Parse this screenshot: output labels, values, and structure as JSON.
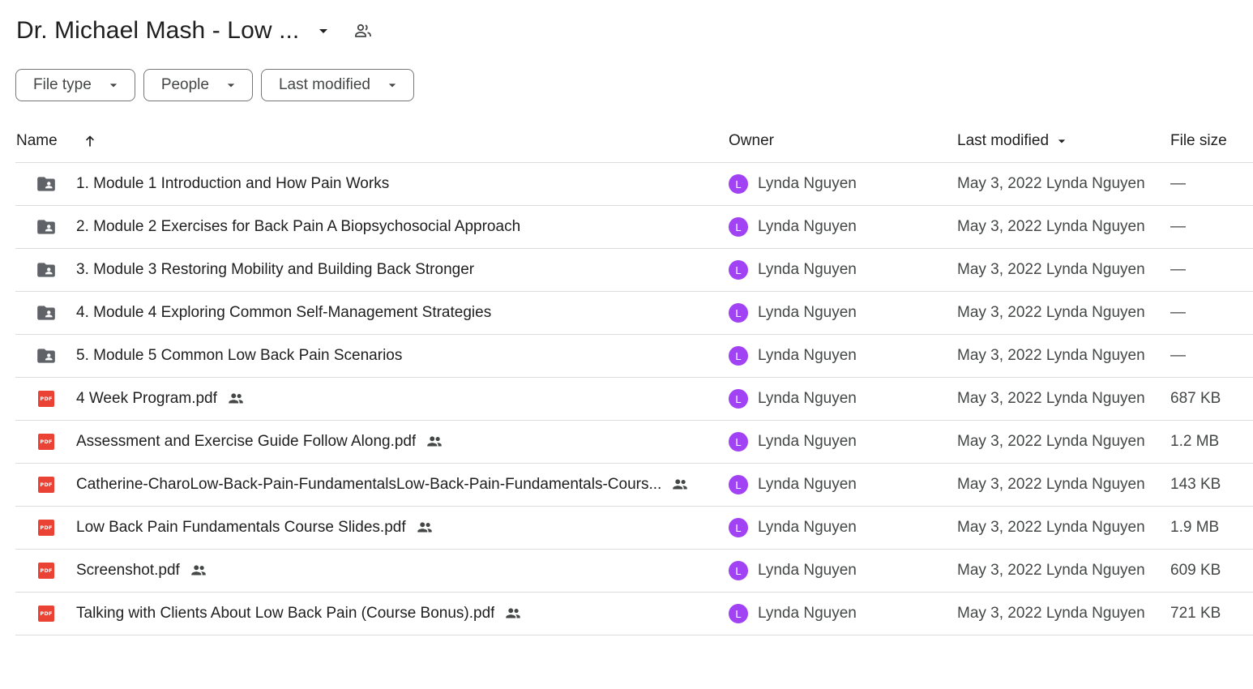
{
  "header": {
    "title": "Dr. Michael Mash - Low ...",
    "title_dropdown_icon": "arrow-drop-down-icon",
    "share_icon": "shared-drive-people-icon"
  },
  "filters": [
    {
      "label": "File type"
    },
    {
      "label": "People"
    },
    {
      "label": "Last modified"
    }
  ],
  "columns": {
    "name": "Name",
    "owner": "Owner",
    "last_modified": "Last modified",
    "file_size": "File size"
  },
  "colors": {
    "avatar": "#a142f4",
    "pdf_red": "#ea4335",
    "folder_gray": "#5f6368",
    "border": "#dadce0"
  },
  "rows": [
    {
      "type": "folder",
      "icon": "shared-folder-icon",
      "name": "1. Module 1 Introduction and How Pain Works",
      "shared": false,
      "owner_initial": "L",
      "owner": "Lynda Nguyen",
      "modified": "May 3, 2022 Lynda Nguyen",
      "size": "—"
    },
    {
      "type": "folder",
      "icon": "shared-folder-icon",
      "name": "2. Module 2 Exercises for Back Pain A Biopsychosocial Approach",
      "shared": false,
      "owner_initial": "L",
      "owner": "Lynda Nguyen",
      "modified": "May 3, 2022 Lynda Nguyen",
      "size": "—"
    },
    {
      "type": "folder",
      "icon": "shared-folder-icon",
      "name": "3. Module 3 Restoring Mobility and Building Back Stronger",
      "shared": false,
      "owner_initial": "L",
      "owner": "Lynda Nguyen",
      "modified": "May 3, 2022 Lynda Nguyen",
      "size": "—"
    },
    {
      "type": "folder",
      "icon": "shared-folder-icon",
      "name": "4. Module 4 Exploring Common Self-Management Strategies",
      "shared": false,
      "owner_initial": "L",
      "owner": "Lynda Nguyen",
      "modified": "May 3, 2022 Lynda Nguyen",
      "size": "—"
    },
    {
      "type": "folder",
      "icon": "shared-folder-icon",
      "name": "5. Module 5 Common Low Back Pain Scenarios",
      "shared": false,
      "owner_initial": "L",
      "owner": "Lynda Nguyen",
      "modified": "May 3, 2022 Lynda Nguyen",
      "size": "—"
    },
    {
      "type": "pdf",
      "icon": "pdf-icon",
      "name": "4 Week Program.pdf",
      "shared": true,
      "owner_initial": "L",
      "owner": "Lynda Nguyen",
      "modified": "May 3, 2022 Lynda Nguyen",
      "size": "687 KB"
    },
    {
      "type": "pdf",
      "icon": "pdf-icon",
      "name": "Assessment and Exercise Guide Follow Along.pdf",
      "shared": true,
      "owner_initial": "L",
      "owner": "Lynda Nguyen",
      "modified": "May 3, 2022 Lynda Nguyen",
      "size": "1.2 MB"
    },
    {
      "type": "pdf",
      "icon": "pdf-icon",
      "name": "Catherine-CharoLow-Back-Pain-FundamentalsLow-Back-Pain-Fundamentals-Cours...",
      "shared": true,
      "owner_initial": "L",
      "owner": "Lynda Nguyen",
      "modified": "May 3, 2022 Lynda Nguyen",
      "size": "143 KB"
    },
    {
      "type": "pdf",
      "icon": "pdf-icon",
      "name": "Low Back Pain Fundamentals Course Slides.pdf",
      "shared": true,
      "owner_initial": "L",
      "owner": "Lynda Nguyen",
      "modified": "May 3, 2022 Lynda Nguyen",
      "size": "1.9 MB"
    },
    {
      "type": "pdf",
      "icon": "pdf-icon",
      "name": "Screenshot.pdf",
      "shared": true,
      "owner_initial": "L",
      "owner": "Lynda Nguyen",
      "modified": "May 3, 2022 Lynda Nguyen",
      "size": "609 KB"
    },
    {
      "type": "pdf",
      "icon": "pdf-icon",
      "name": "Talking with Clients About Low Back Pain (Course Bonus).pdf",
      "shared": true,
      "owner_initial": "L",
      "owner": "Lynda Nguyen",
      "modified": "May 3, 2022 Lynda Nguyen",
      "size": "721 KB"
    }
  ]
}
